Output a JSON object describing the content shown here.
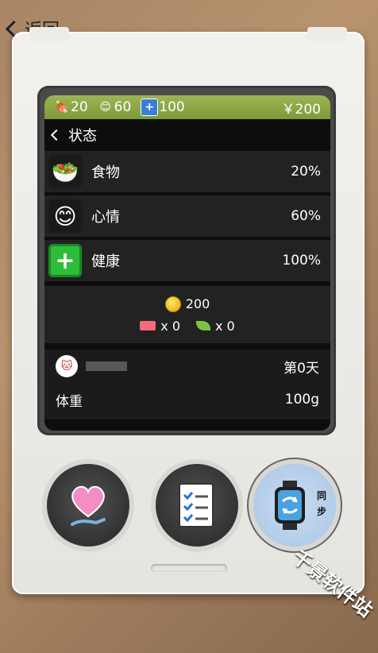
{
  "nav": {
    "back_label": "返回"
  },
  "topbar": {
    "food_count": "20",
    "mood_count": "60",
    "health_count": "100",
    "money": "￥200"
  },
  "screen": {
    "title": "状态",
    "stats": [
      {
        "label": "食物",
        "value": "20%"
      },
      {
        "label": "心情",
        "value": "60%"
      },
      {
        "label": "健康",
        "value": "100%"
      }
    ],
    "coins": "200",
    "ticket_count": "x 0",
    "leaf_count": "x 0",
    "pet": {
      "day_label": "第0天",
      "weight_label": "体重",
      "weight_value": "100g"
    }
  },
  "buttons": {
    "sync_label": "同步"
  },
  "watermark": "千景软件站"
}
